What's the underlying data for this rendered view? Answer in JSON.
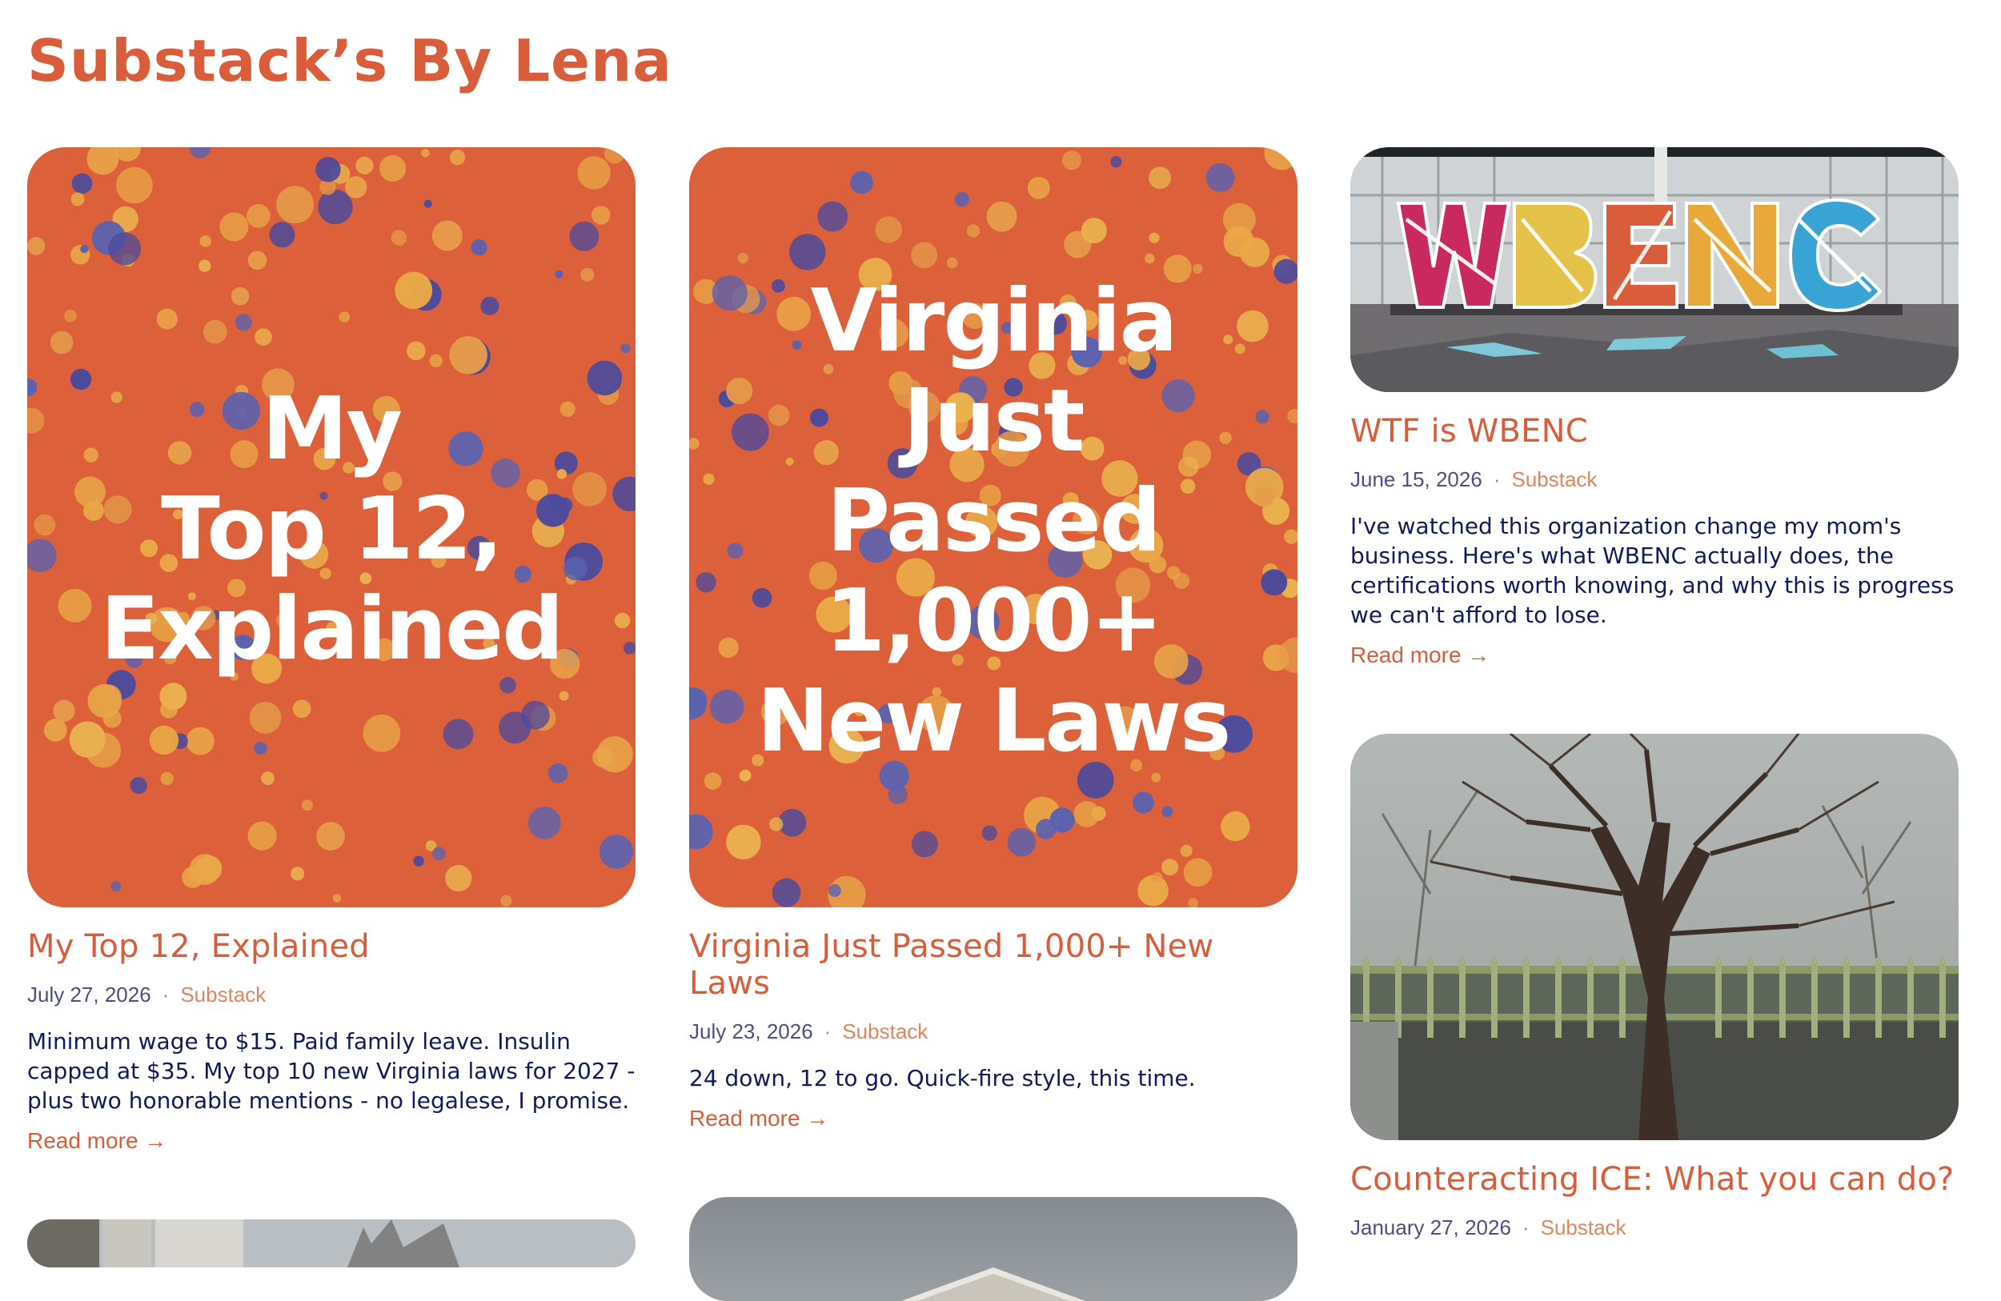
{
  "page": {
    "title": "Substack’s By Lena"
  },
  "colors": {
    "accent": "#d95d3a",
    "cover_bg": "#dc603a",
    "meta_date": "#4b4f82",
    "meta_source": "#e0865f",
    "excerpt": "#101a5c"
  },
  "posts": [
    {
      "cover_lines": [
        "My",
        "Top 12,",
        "Explained"
      ],
      "title": "My Top 12, Explained",
      "date": "July 27, 2026",
      "source": "Substack",
      "excerpt": "Minimum wage to $15. Paid family leave. Insulin capped at $35. My top 10 new Virginia laws for 2027 - plus two honorable mentions - no legalese, I promise.",
      "read_more": "Read more →"
    },
    {
      "cover_lines": [
        "Virginia",
        "Just",
        "Passed",
        "1,000+",
        "New Laws"
      ],
      "title": "Virginia Just Passed 1,000+ New Laws",
      "date": "July 23, 2026",
      "source": "Substack",
      "excerpt": "24 down, 12 to go. Quick-fire style, this time.",
      "read_more": "Read more →"
    },
    {
      "image_alt_icon": "wbenc-sign-photo",
      "title": "WTF is WBENC",
      "date": "June 15, 2026",
      "source": "Substack",
      "excerpt": "I've watched this organization change my mom's business. Here's what WBENC actually does, the certifications worth knowing, and why this is progress we can't afford to lose.",
      "read_more": "Read more →"
    },
    {
      "image_alt_icon": "tree-garden-photo",
      "title": "Counteracting ICE: What you can do?",
      "date": "January 27, 2026",
      "source": "Substack"
    }
  ],
  "meta_separator": "·"
}
